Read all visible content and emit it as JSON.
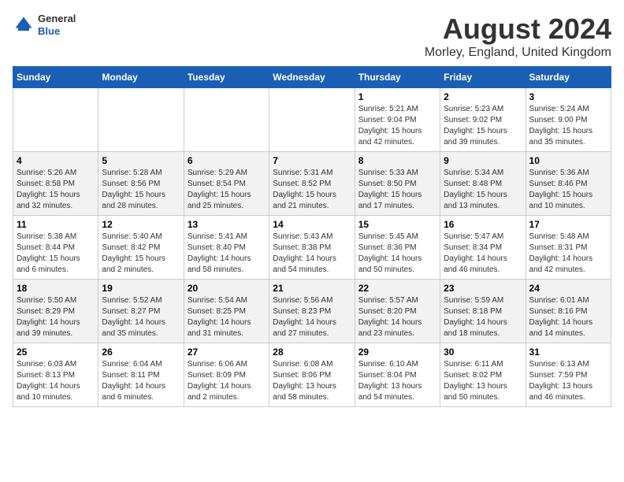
{
  "header": {
    "logo_general": "General",
    "logo_blue": "Blue",
    "main_title": "August 2024",
    "subtitle": "Morley, England, United Kingdom"
  },
  "weekdays": [
    "Sunday",
    "Monday",
    "Tuesday",
    "Wednesday",
    "Thursday",
    "Friday",
    "Saturday"
  ],
  "weeks": [
    {
      "days": [
        {
          "num": "",
          "info": ""
        },
        {
          "num": "",
          "info": ""
        },
        {
          "num": "",
          "info": ""
        },
        {
          "num": "",
          "info": ""
        },
        {
          "num": "1",
          "info": "Sunrise: 5:21 AM\nSunset: 9:04 PM\nDaylight: 15 hours and 42 minutes."
        },
        {
          "num": "2",
          "info": "Sunrise: 5:23 AM\nSunset: 9:02 PM\nDaylight: 15 hours and 39 minutes."
        },
        {
          "num": "3",
          "info": "Sunrise: 5:24 AM\nSunset: 9:00 PM\nDaylight: 15 hours and 35 minutes."
        }
      ]
    },
    {
      "days": [
        {
          "num": "4",
          "info": "Sunrise: 5:26 AM\nSunset: 8:58 PM\nDaylight: 15 hours and 32 minutes."
        },
        {
          "num": "5",
          "info": "Sunrise: 5:28 AM\nSunset: 8:56 PM\nDaylight: 15 hours and 28 minutes."
        },
        {
          "num": "6",
          "info": "Sunrise: 5:29 AM\nSunset: 8:54 PM\nDaylight: 15 hours and 25 minutes."
        },
        {
          "num": "7",
          "info": "Sunrise: 5:31 AM\nSunset: 8:52 PM\nDaylight: 15 hours and 21 minutes."
        },
        {
          "num": "8",
          "info": "Sunrise: 5:33 AM\nSunset: 8:50 PM\nDaylight: 15 hours and 17 minutes."
        },
        {
          "num": "9",
          "info": "Sunrise: 5:34 AM\nSunset: 8:48 PM\nDaylight: 15 hours and 13 minutes."
        },
        {
          "num": "10",
          "info": "Sunrise: 5:36 AM\nSunset: 8:46 PM\nDaylight: 15 hours and 10 minutes."
        }
      ]
    },
    {
      "days": [
        {
          "num": "11",
          "info": "Sunrise: 5:38 AM\nSunset: 8:44 PM\nDaylight: 15 hours and 6 minutes."
        },
        {
          "num": "12",
          "info": "Sunrise: 5:40 AM\nSunset: 8:42 PM\nDaylight: 15 hours and 2 minutes."
        },
        {
          "num": "13",
          "info": "Sunrise: 5:41 AM\nSunset: 8:40 PM\nDaylight: 14 hours and 58 minutes."
        },
        {
          "num": "14",
          "info": "Sunrise: 5:43 AM\nSunset: 8:38 PM\nDaylight: 14 hours and 54 minutes."
        },
        {
          "num": "15",
          "info": "Sunrise: 5:45 AM\nSunset: 8:36 PM\nDaylight: 14 hours and 50 minutes."
        },
        {
          "num": "16",
          "info": "Sunrise: 5:47 AM\nSunset: 8:34 PM\nDaylight: 14 hours and 46 minutes."
        },
        {
          "num": "17",
          "info": "Sunrise: 5:48 AM\nSunset: 8:31 PM\nDaylight: 14 hours and 42 minutes."
        }
      ]
    },
    {
      "days": [
        {
          "num": "18",
          "info": "Sunrise: 5:50 AM\nSunset: 8:29 PM\nDaylight: 14 hours and 39 minutes."
        },
        {
          "num": "19",
          "info": "Sunrise: 5:52 AM\nSunset: 8:27 PM\nDaylight: 14 hours and 35 minutes."
        },
        {
          "num": "20",
          "info": "Sunrise: 5:54 AM\nSunset: 8:25 PM\nDaylight: 14 hours and 31 minutes."
        },
        {
          "num": "21",
          "info": "Sunrise: 5:56 AM\nSunset: 8:23 PM\nDaylight: 14 hours and 27 minutes."
        },
        {
          "num": "22",
          "info": "Sunrise: 5:57 AM\nSunset: 8:20 PM\nDaylight: 14 hours and 23 minutes."
        },
        {
          "num": "23",
          "info": "Sunrise: 5:59 AM\nSunset: 8:18 PM\nDaylight: 14 hours and 18 minutes."
        },
        {
          "num": "24",
          "info": "Sunrise: 6:01 AM\nSunset: 8:16 PM\nDaylight: 14 hours and 14 minutes."
        }
      ]
    },
    {
      "days": [
        {
          "num": "25",
          "info": "Sunrise: 6:03 AM\nSunset: 8:13 PM\nDaylight: 14 hours and 10 minutes."
        },
        {
          "num": "26",
          "info": "Sunrise: 6:04 AM\nSunset: 8:11 PM\nDaylight: 14 hours and 6 minutes."
        },
        {
          "num": "27",
          "info": "Sunrise: 6:06 AM\nSunset: 8:09 PM\nDaylight: 14 hours and 2 minutes."
        },
        {
          "num": "28",
          "info": "Sunrise: 6:08 AM\nSunset: 8:06 PM\nDaylight: 13 hours and 58 minutes."
        },
        {
          "num": "29",
          "info": "Sunrise: 6:10 AM\nSunset: 8:04 PM\nDaylight: 13 hours and 54 minutes."
        },
        {
          "num": "30",
          "info": "Sunrise: 6:11 AM\nSunset: 8:02 PM\nDaylight: 13 hours and 50 minutes."
        },
        {
          "num": "31",
          "info": "Sunrise: 6:13 AM\nSunset: 7:59 PM\nDaylight: 13 hours and 46 minutes."
        }
      ]
    }
  ]
}
